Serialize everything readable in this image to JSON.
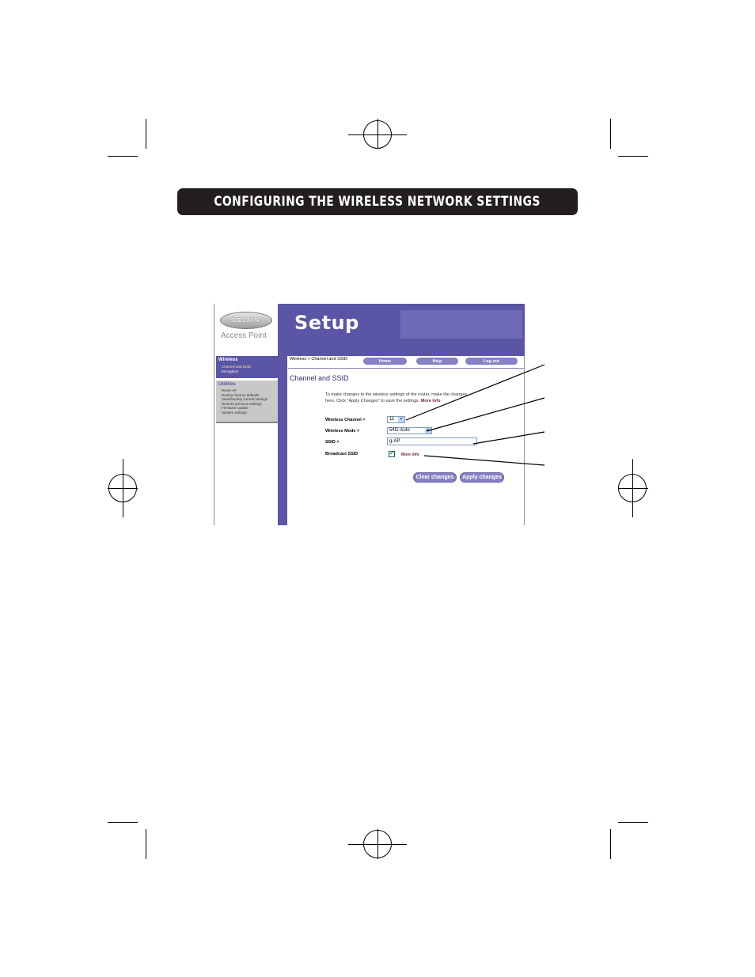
{
  "header": {
    "title": "CONFIGURING THE WIRELESS NETWORK SETTINGS"
  },
  "screenshot": {
    "brand": "BELKIN",
    "product": "Access Point",
    "page_heading": "Setup",
    "nav": {
      "wireless_head": "Wireless",
      "wireless_items": [
        "Channel and SSID",
        "Encryption"
      ],
      "utilities_head": "Utilities",
      "utilities_items": [
        "Reset AP",
        "Restore factory defaults",
        "Save/backup current settings",
        "Restore previous settings",
        "Firmware update",
        "System settings"
      ]
    },
    "breadcrumb": "Wireless > Channel and SSID",
    "top_buttons": {
      "home": "Home",
      "help": "Help",
      "logout": "Log-out"
    },
    "section_title": "Channel and SSID",
    "intro_line1": "To make changes to the wireless settings of the router, make the changes",
    "intro_line2": "here. Click \"Apply Changes\" to save the settings.",
    "more_info": "More Info",
    "fields": {
      "channel_label": "Wireless Channel >",
      "channel_value": "11",
      "mode_label": "Wireless Mode >",
      "mode_value": "54G-Auto",
      "ssid_label": "SSID >",
      "ssid_value": "g-AP",
      "broadcast_label": "Broadcast SSID",
      "broadcast_checked": "✔"
    },
    "buttons": {
      "clear": "Clear changes",
      "apply": "Apply changes"
    },
    "icons": {
      "dropdown": "chevron-down-icon",
      "checkbox": "check-icon"
    }
  },
  "colors": {
    "accent": "#5b55a6",
    "button": "#8581c2",
    "header_bar": "#231f20"
  }
}
